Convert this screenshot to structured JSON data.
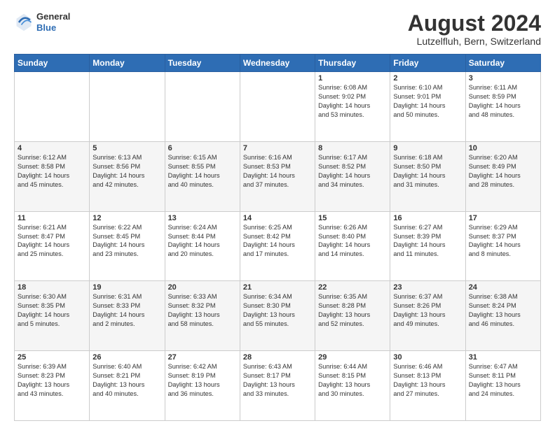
{
  "header": {
    "logo": {
      "general": "General",
      "blue": "Blue"
    },
    "title": "August 2024",
    "subtitle": "Lutzelfluh, Bern, Switzerland"
  },
  "weekdays": [
    "Sunday",
    "Monday",
    "Tuesday",
    "Wednesday",
    "Thursday",
    "Friday",
    "Saturday"
  ],
  "weeks": [
    [
      {
        "day": "",
        "info": ""
      },
      {
        "day": "",
        "info": ""
      },
      {
        "day": "",
        "info": ""
      },
      {
        "day": "",
        "info": ""
      },
      {
        "day": "1",
        "info": "Sunrise: 6:08 AM\nSunset: 9:02 PM\nDaylight: 14 hours\nand 53 minutes."
      },
      {
        "day": "2",
        "info": "Sunrise: 6:10 AM\nSunset: 9:01 PM\nDaylight: 14 hours\nand 50 minutes."
      },
      {
        "day": "3",
        "info": "Sunrise: 6:11 AM\nSunset: 8:59 PM\nDaylight: 14 hours\nand 48 minutes."
      }
    ],
    [
      {
        "day": "4",
        "info": "Sunrise: 6:12 AM\nSunset: 8:58 PM\nDaylight: 14 hours\nand 45 minutes."
      },
      {
        "day": "5",
        "info": "Sunrise: 6:13 AM\nSunset: 8:56 PM\nDaylight: 14 hours\nand 42 minutes."
      },
      {
        "day": "6",
        "info": "Sunrise: 6:15 AM\nSunset: 8:55 PM\nDaylight: 14 hours\nand 40 minutes."
      },
      {
        "day": "7",
        "info": "Sunrise: 6:16 AM\nSunset: 8:53 PM\nDaylight: 14 hours\nand 37 minutes."
      },
      {
        "day": "8",
        "info": "Sunrise: 6:17 AM\nSunset: 8:52 PM\nDaylight: 14 hours\nand 34 minutes."
      },
      {
        "day": "9",
        "info": "Sunrise: 6:18 AM\nSunset: 8:50 PM\nDaylight: 14 hours\nand 31 minutes."
      },
      {
        "day": "10",
        "info": "Sunrise: 6:20 AM\nSunset: 8:49 PM\nDaylight: 14 hours\nand 28 minutes."
      }
    ],
    [
      {
        "day": "11",
        "info": "Sunrise: 6:21 AM\nSunset: 8:47 PM\nDaylight: 14 hours\nand 25 minutes."
      },
      {
        "day": "12",
        "info": "Sunrise: 6:22 AM\nSunset: 8:45 PM\nDaylight: 14 hours\nand 23 minutes."
      },
      {
        "day": "13",
        "info": "Sunrise: 6:24 AM\nSunset: 8:44 PM\nDaylight: 14 hours\nand 20 minutes."
      },
      {
        "day": "14",
        "info": "Sunrise: 6:25 AM\nSunset: 8:42 PM\nDaylight: 14 hours\nand 17 minutes."
      },
      {
        "day": "15",
        "info": "Sunrise: 6:26 AM\nSunset: 8:40 PM\nDaylight: 14 hours\nand 14 minutes."
      },
      {
        "day": "16",
        "info": "Sunrise: 6:27 AM\nSunset: 8:39 PM\nDaylight: 14 hours\nand 11 minutes."
      },
      {
        "day": "17",
        "info": "Sunrise: 6:29 AM\nSunset: 8:37 PM\nDaylight: 14 hours\nand 8 minutes."
      }
    ],
    [
      {
        "day": "18",
        "info": "Sunrise: 6:30 AM\nSunset: 8:35 PM\nDaylight: 14 hours\nand 5 minutes."
      },
      {
        "day": "19",
        "info": "Sunrise: 6:31 AM\nSunset: 8:33 PM\nDaylight: 14 hours\nand 2 minutes."
      },
      {
        "day": "20",
        "info": "Sunrise: 6:33 AM\nSunset: 8:32 PM\nDaylight: 13 hours\nand 58 minutes."
      },
      {
        "day": "21",
        "info": "Sunrise: 6:34 AM\nSunset: 8:30 PM\nDaylight: 13 hours\nand 55 minutes."
      },
      {
        "day": "22",
        "info": "Sunrise: 6:35 AM\nSunset: 8:28 PM\nDaylight: 13 hours\nand 52 minutes."
      },
      {
        "day": "23",
        "info": "Sunrise: 6:37 AM\nSunset: 8:26 PM\nDaylight: 13 hours\nand 49 minutes."
      },
      {
        "day": "24",
        "info": "Sunrise: 6:38 AM\nSunset: 8:24 PM\nDaylight: 13 hours\nand 46 minutes."
      }
    ],
    [
      {
        "day": "25",
        "info": "Sunrise: 6:39 AM\nSunset: 8:23 PM\nDaylight: 13 hours\nand 43 minutes."
      },
      {
        "day": "26",
        "info": "Sunrise: 6:40 AM\nSunset: 8:21 PM\nDaylight: 13 hours\nand 40 minutes."
      },
      {
        "day": "27",
        "info": "Sunrise: 6:42 AM\nSunset: 8:19 PM\nDaylight: 13 hours\nand 36 minutes."
      },
      {
        "day": "28",
        "info": "Sunrise: 6:43 AM\nSunset: 8:17 PM\nDaylight: 13 hours\nand 33 minutes."
      },
      {
        "day": "29",
        "info": "Sunrise: 6:44 AM\nSunset: 8:15 PM\nDaylight: 13 hours\nand 30 minutes."
      },
      {
        "day": "30",
        "info": "Sunrise: 6:46 AM\nSunset: 8:13 PM\nDaylight: 13 hours\nand 27 minutes."
      },
      {
        "day": "31",
        "info": "Sunrise: 6:47 AM\nSunset: 8:11 PM\nDaylight: 13 hours\nand 24 minutes."
      }
    ]
  ]
}
